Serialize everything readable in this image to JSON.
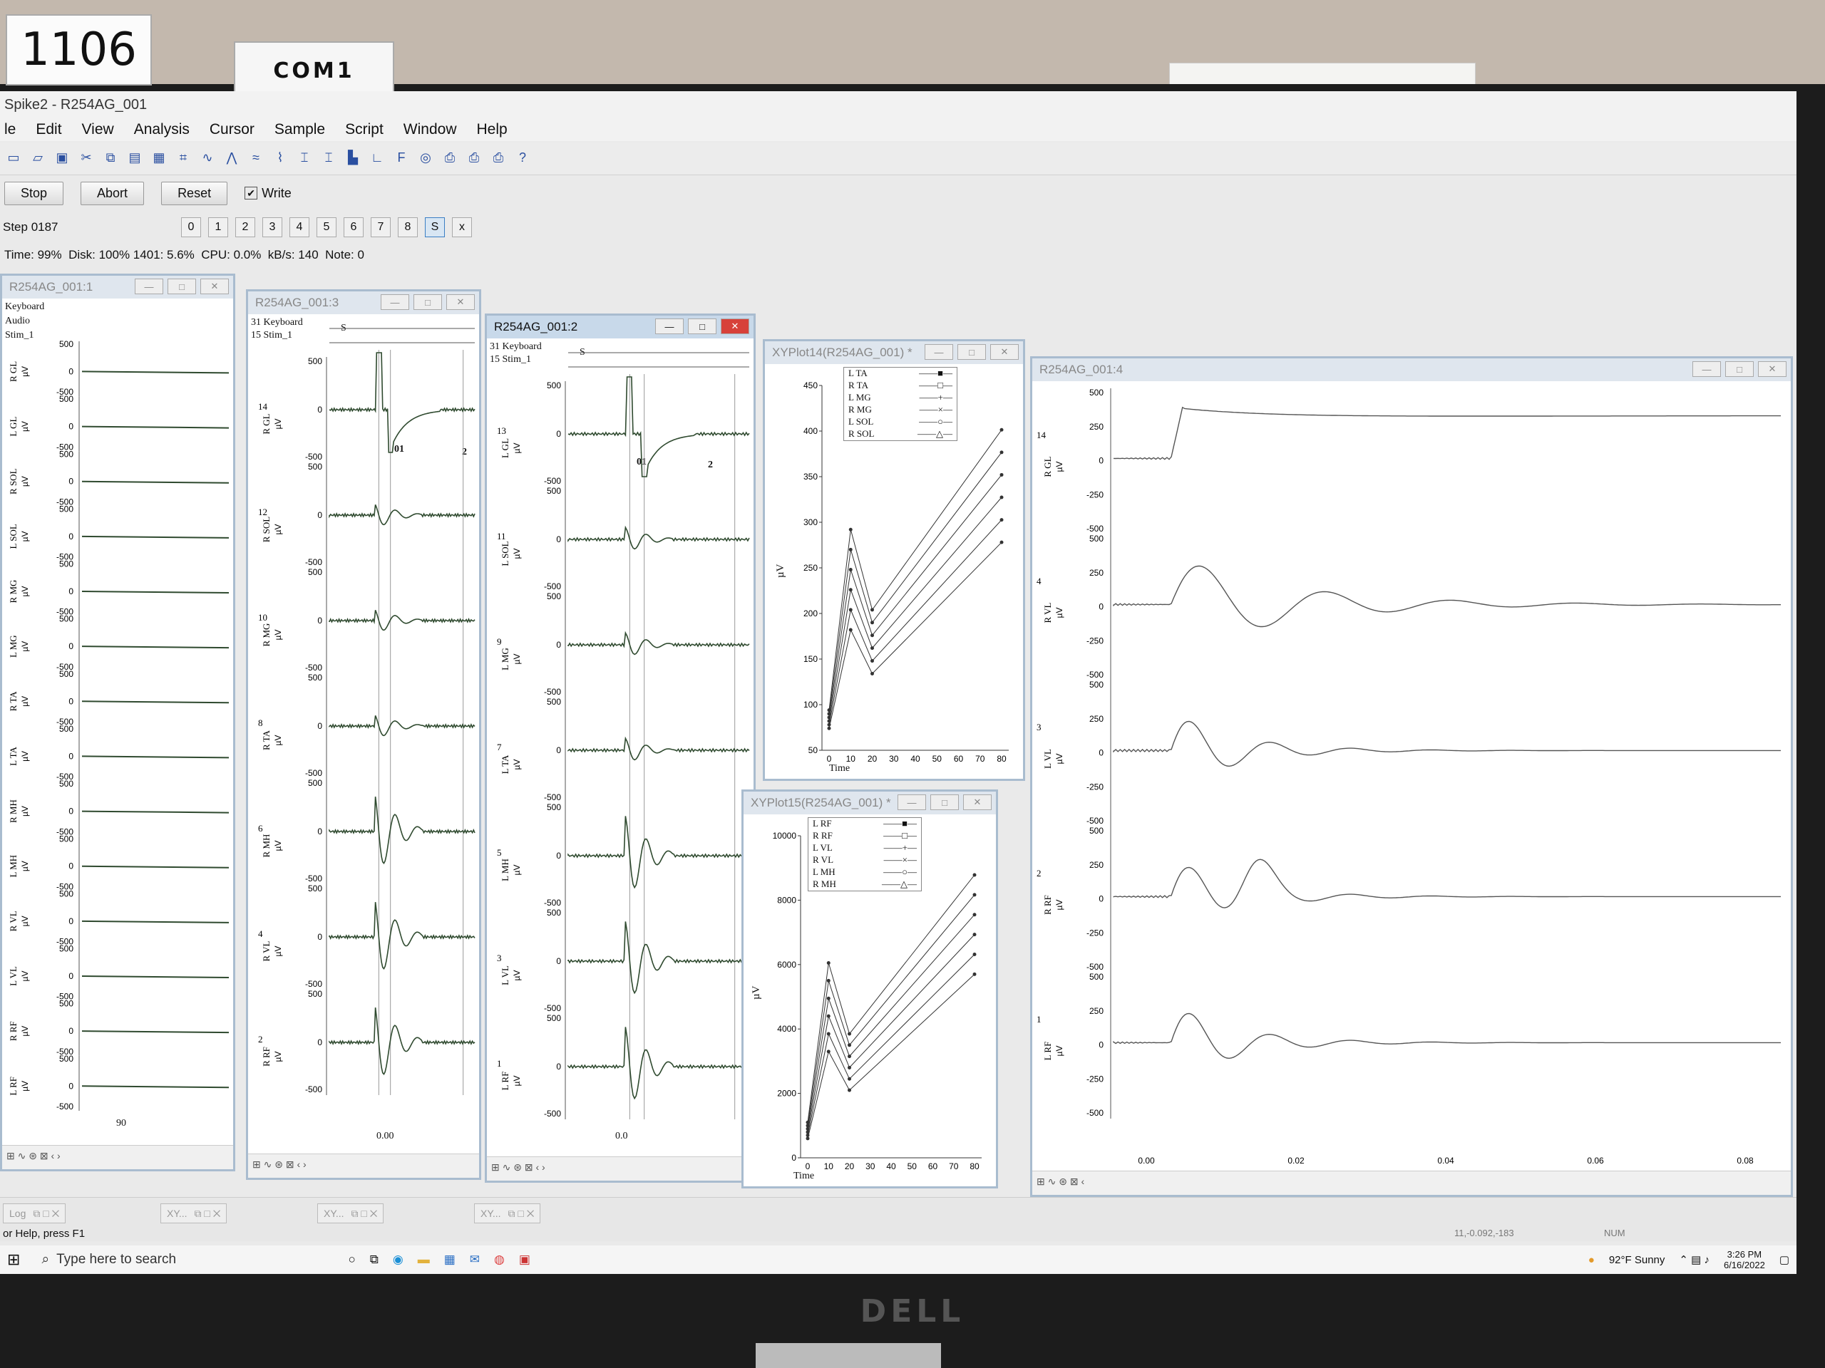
{
  "physical": {
    "label_number": "1106",
    "label_port": "COM1",
    "monitor_brand": "DELL"
  },
  "app": {
    "title": "Spike2 - R254AG_001",
    "menu": [
      "le",
      "Edit",
      "View",
      "Analysis",
      "Cursor",
      "Sample",
      "Script",
      "Window",
      "Help"
    ],
    "buttons": {
      "stop": "Stop",
      "abort": "Abort",
      "reset": "Reset",
      "write": "Write"
    },
    "write_checked": true,
    "step": "Step 0187",
    "step_buttons": [
      "0",
      "1",
      "2",
      "3",
      "4",
      "5",
      "6",
      "7",
      "8",
      "S",
      "x"
    ],
    "status": {
      "time": "Time: 99%",
      "disk": "Disk: 100% 1401: 5.6%",
      "cpu": "CPU: 0.0%",
      "kbs": "kB/s: 140",
      "note": "Note: 0"
    },
    "statusbar_left": "or Help, press F1",
    "statusbar_coords": "11,-0.092,-183",
    "statusbar_num": "NUM"
  },
  "win1": {
    "title": "R254AG_001:1",
    "channels_top": [
      "Keyboard",
      "Audio",
      "Stim_1"
    ],
    "traces": [
      "R GL",
      "L GL",
      "R SOL",
      "L SOL",
      "R MG",
      "L MG",
      "R TA",
      "L TA",
      "R MH",
      "L MH",
      "R VL",
      "L VL",
      "R RF",
      "L RF"
    ],
    "unit": "µV",
    "tick_top": "500",
    "tick_mid": "0",
    "tick_bot": "-500",
    "xaxis": "90"
  },
  "win3": {
    "title": "R254AG_001:3",
    "header": [
      "31 Keyboard",
      "15 Stim_1"
    ],
    "marker_s": "S",
    "cursor_labels": [
      "01",
      "2"
    ],
    "traces": [
      {
        "num": "14",
        "name": "R GL"
      },
      {
        "num": "12",
        "name": "R SOL"
      },
      {
        "num": "10",
        "name": "R MG"
      },
      {
        "num": "8",
        "name": "R TA"
      },
      {
        "num": "6",
        "name": "R MH"
      },
      {
        "num": "4",
        "name": "R VL"
      },
      {
        "num": "2",
        "name": "R RF"
      }
    ],
    "unit": "µV",
    "xaxis": "0.00"
  },
  "win2": {
    "title": "R254AG_001:2",
    "header": [
      "31 Keyboard",
      "15 Stim_1"
    ],
    "marker_s": "S",
    "cursor_labels": [
      "01",
      "2"
    ],
    "traces": [
      {
        "num": "13",
        "name": "L GL"
      },
      {
        "num": "11",
        "name": "L SOL"
      },
      {
        "num": "9",
        "name": "L MG"
      },
      {
        "num": "7",
        "name": "L TA"
      },
      {
        "num": "5",
        "name": "L MH"
      },
      {
        "num": "3",
        "name": "L VL"
      },
      {
        "num": "1",
        "name": "L RF"
      }
    ],
    "unit": "µV",
    "xaxis": "0.0"
  },
  "xy14": {
    "title": "XYPlot14(R254AG_001) *",
    "legend": [
      "L TA",
      "R TA",
      "L MG",
      "R MG",
      "L SOL",
      "R SOL"
    ],
    "yticks": [
      "450",
      "400",
      "350",
      "300",
      "250",
      "200",
      "150",
      "100",
      "50"
    ],
    "xticks": [
      "0",
      "10",
      "20",
      "30",
      "40",
      "50",
      "60",
      "70",
      "80"
    ],
    "ylabel": "µV",
    "xlabel": "Time"
  },
  "xy15": {
    "title": "XYPlot15(R254AG_001) *",
    "legend": [
      "L RF",
      "R RF",
      "L VL",
      "R VL",
      "L MH",
      "R MH"
    ],
    "yticks": [
      "10000",
      "8000",
      "6000",
      "4000",
      "2000",
      "0"
    ],
    "xticks": [
      "0",
      "10",
      "20",
      "30",
      "40",
      "50",
      "60",
      "70",
      "80"
    ],
    "ylabel": "µV",
    "xlabel": "Time"
  },
  "win4": {
    "title": "R254AG_001:4",
    "traces": [
      {
        "num": "14",
        "name": "R GL"
      },
      {
        "num": "4",
        "name": "R VL"
      },
      {
        "num": "3",
        "name": "L VL"
      },
      {
        "num": "2",
        "name": "R RF"
      },
      {
        "num": "1",
        "name": "L RF"
      }
    ],
    "unit": "µV",
    "ticks_a": [
      "500",
      "250",
      "0",
      "-250",
      "-500"
    ],
    "xticks": [
      "0.00",
      "0.02",
      "0.04",
      "0.06",
      "0.08"
    ]
  },
  "windows_bar": {
    "tabs": [
      "Log",
      "XY...",
      "XY...",
      "XY..."
    ]
  },
  "taskbar": {
    "search_placeholder": "Type here to search",
    "weather": "92°F Sunny",
    "time": "3:26 PM",
    "date": "6/16/2022"
  },
  "colors": {
    "trace": "#2f4a2f",
    "active_title": "#c8d9ea",
    "inactive_title": "#dfe6ee",
    "close_red": "#d7413a"
  }
}
